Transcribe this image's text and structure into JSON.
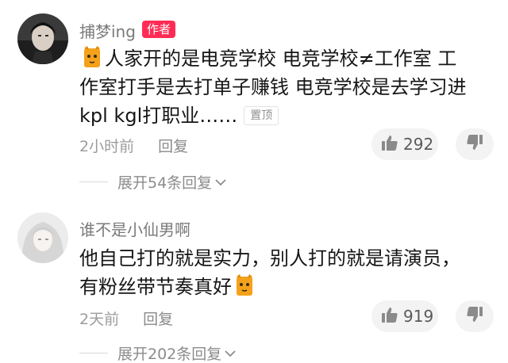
{
  "comments": [
    {
      "username": "捕梦ing",
      "badge": "作者",
      "lines": [
        "人家开的是电竞学校  电竞学校≠工作室  工",
        "作室打手是去打单子赚钱  电竞学校是去学习进",
        "kpl kgl打职业……"
      ],
      "pin_label": "置顶",
      "time": "2小时前",
      "reply_label": "回复",
      "likes": "292",
      "expand_label": "展开54条回复"
    },
    {
      "username": "谁不是小仙男啊",
      "lines": [
        "他自己打的就是实力，别人打的就是请演员，",
        "有粉丝带节奏真好"
      ],
      "time": "2天前",
      "reply_label": "回复",
      "likes": "919",
      "expand_label": "展开202条回复"
    }
  ],
  "colors": {
    "badge": "#fe2c55",
    "text_primary": "#161616",
    "text_secondary": "#9c9c9c",
    "pill_bg": "#f3f3f3"
  },
  "icons": [
    "cat-emoji-icon",
    "thumbs-up-icon",
    "thumbs-down-icon",
    "chevron-down-icon"
  ]
}
